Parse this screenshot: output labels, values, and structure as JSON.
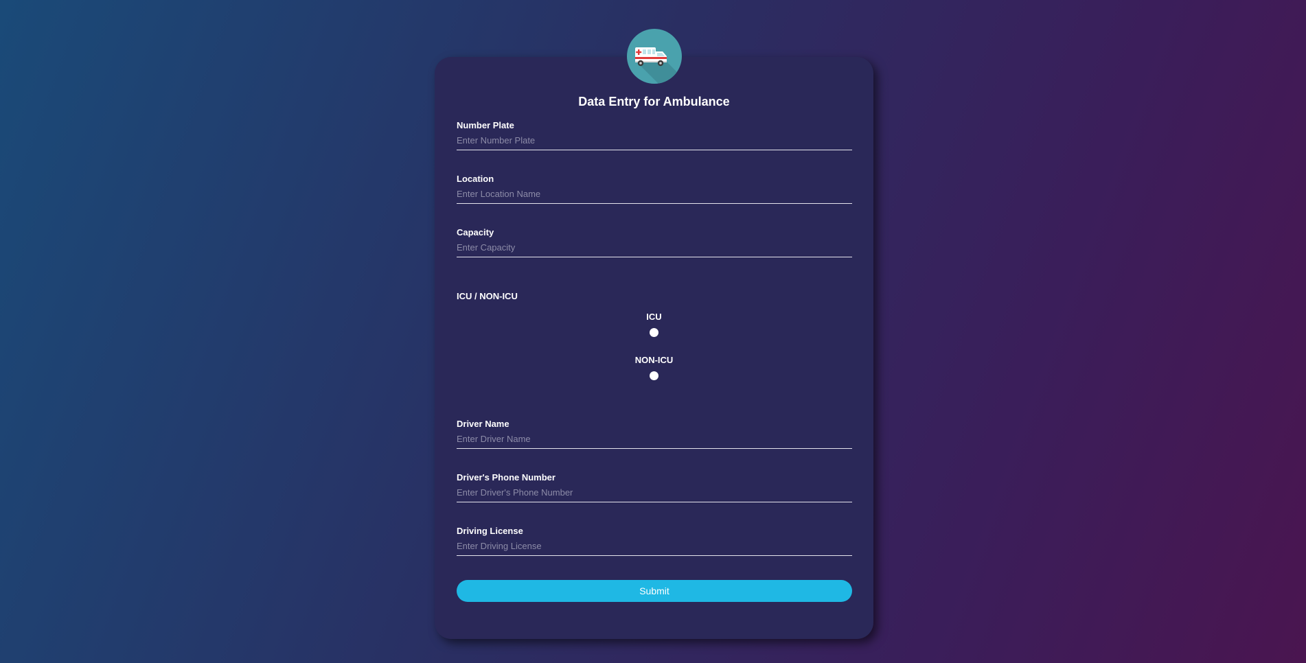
{
  "form": {
    "title": "Data Entry for Ambulance",
    "logo_icon": "ambulance-icon",
    "fields": [
      {
        "label": "Number Plate",
        "placeholder": "Enter Number Plate",
        "value": ""
      },
      {
        "label": "Location",
        "placeholder": "Enter Location Name",
        "value": ""
      },
      {
        "label": "Capacity",
        "placeholder": "Enter Capacity",
        "value": ""
      },
      {
        "label": "Driver Name",
        "placeholder": "Enter Driver Name",
        "value": ""
      },
      {
        "label": "Driver's Phone Number",
        "placeholder": "Enter Driver's Phone Number",
        "value": ""
      },
      {
        "label": "Driving License",
        "placeholder": "Enter Driving License",
        "value": ""
      }
    ],
    "icu_section": {
      "label": "ICU / NON-ICU",
      "options": [
        {
          "label": "ICU",
          "selected": false
        },
        {
          "label": "NON-ICU",
          "selected": false
        }
      ]
    },
    "submit_label": "Submit"
  },
  "colors": {
    "accent": "#1fb8e4",
    "card": "#2a2858",
    "logo_bg": "#4aa2ad"
  }
}
